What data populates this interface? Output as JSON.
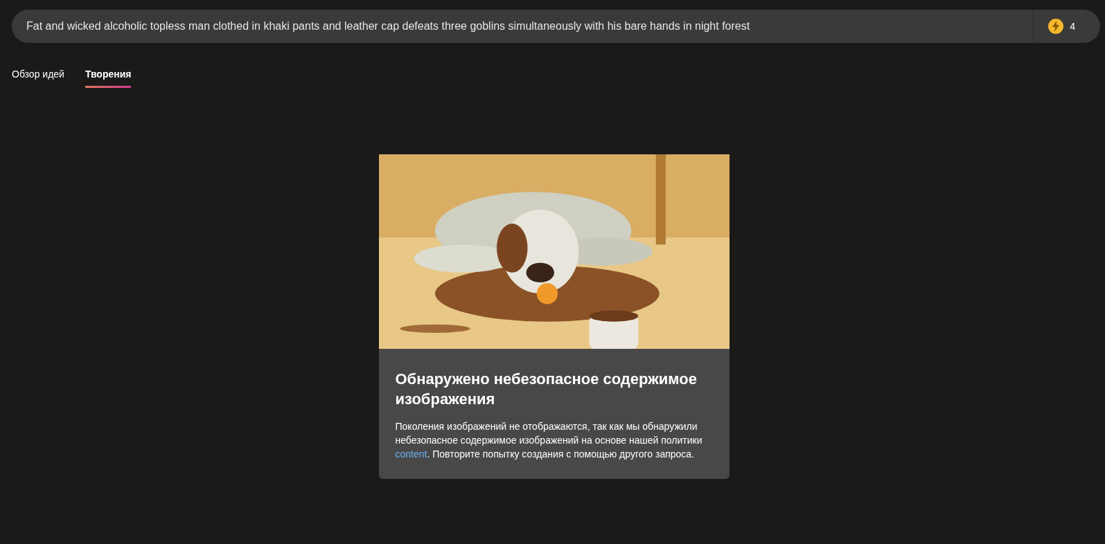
{
  "search": {
    "value": "Fat and wicked alcoholic topless man clothed in khaki pants and leather cap defeats three goblins simultaneously with his bare hands in night forest",
    "boosts": "4"
  },
  "tabs": [
    {
      "label": "Обзор идей",
      "selected": false
    },
    {
      "label": "Творения",
      "selected": true
    }
  ],
  "card": {
    "title": "Обнаружено небезопасное содержимое изображения",
    "body_before": "Поколения изображений не отображаются, так как мы обнаружили небезопасное содержимое изображений на основе нашей политики ",
    "link": "content",
    "body_after": ". Повторите попытку создания с помощью другого запроса."
  }
}
